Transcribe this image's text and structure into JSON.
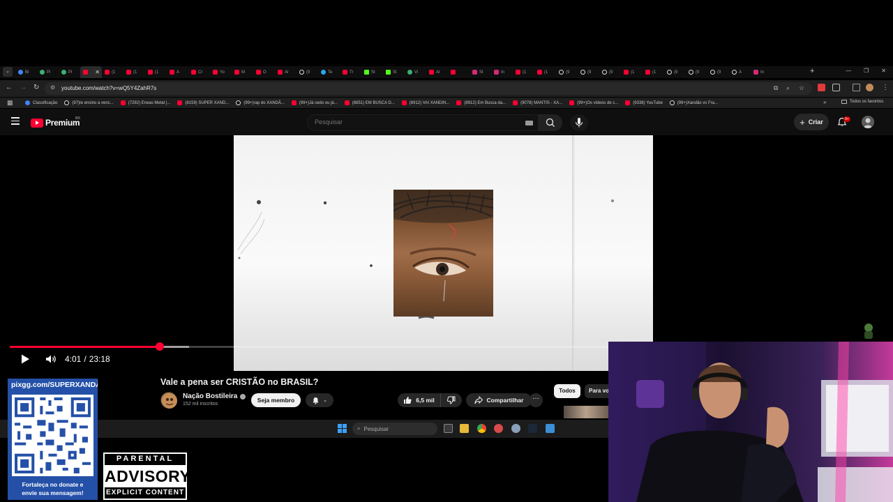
{
  "browser": {
    "tabs": [
      {
        "icon": "chrome-icon",
        "label": "Bi",
        "fav": "ch"
      },
      {
        "icon": "green-icon",
        "label": "Pi",
        "fav": "gn"
      },
      {
        "icon": "green-icon",
        "label": "Pi",
        "fav": "gn"
      },
      {
        "icon": "youtube-icon",
        "label": "",
        "fav": "yt",
        "active": true
      },
      {
        "icon": "youtube-icon",
        "label": "(1",
        "fav": "yt"
      },
      {
        "icon": "youtube-icon",
        "label": "(1",
        "fav": "yt"
      },
      {
        "icon": "youtube-icon",
        "label": "(1",
        "fav": "yt"
      },
      {
        "icon": "youtube-icon",
        "label": "A",
        "fav": "yt"
      },
      {
        "icon": "youtube-icon",
        "label": "Cr",
        "fav": "yt"
      },
      {
        "icon": "youtube-icon",
        "label": "Yo",
        "fav": "yt"
      },
      {
        "icon": "youtube-icon",
        "label": "M",
        "fav": "yt"
      },
      {
        "icon": "youtube-icon",
        "label": "O",
        "fav": "yt"
      },
      {
        "icon": "youtube-icon",
        "label": "Al",
        "fav": "yt"
      },
      {
        "icon": "tiktok-icon",
        "label": "(9",
        "fav": "tt"
      },
      {
        "icon": "telegram-icon",
        "label": "Te",
        "fav": "tg"
      },
      {
        "icon": "youtube-icon",
        "label": "Tr",
        "fav": "yt"
      },
      {
        "icon": "kick-icon",
        "label": "St",
        "fav": "kk"
      },
      {
        "icon": "kick-icon",
        "label": "St",
        "fav": "kk"
      },
      {
        "icon": "globe-icon",
        "label": "Vi",
        "fav": "gn"
      },
      {
        "icon": "youtube-icon",
        "label": "Al",
        "fav": "yt"
      },
      {
        "icon": "youtube-icon",
        "label": "",
        "fav": "yt"
      },
      {
        "icon": "instagram-icon",
        "label": "St",
        "fav": "ig"
      },
      {
        "icon": "instagram-icon",
        "label": "In",
        "fav": "ig"
      },
      {
        "icon": "youtube-icon",
        "label": "(1",
        "fav": "yt"
      },
      {
        "icon": "youtube-icon",
        "label": "(1",
        "fav": "yt"
      },
      {
        "icon": "tiktok-icon",
        "label": "(9",
        "fav": "tt"
      },
      {
        "icon": "tiktok-icon",
        "label": "(9",
        "fav": "tt"
      },
      {
        "icon": "tiktok-icon",
        "label": "(9",
        "fav": "tt"
      },
      {
        "icon": "youtube-icon",
        "label": "(1",
        "fav": "yt"
      },
      {
        "icon": "youtube-icon",
        "label": "(1",
        "fav": "yt"
      },
      {
        "icon": "tiktok-icon",
        "label": "(9",
        "fav": "tt"
      },
      {
        "icon": "tiktok-icon",
        "label": "(9",
        "fav": "tt"
      },
      {
        "icon": "tiktok-icon",
        "label": "(9",
        "fav": "tt"
      },
      {
        "icon": "tiktok-icon",
        "label": "A",
        "fav": "tt"
      },
      {
        "icon": "instagram-icon",
        "label": "In",
        "fav": "ig"
      }
    ],
    "url": "youtube.com/watch?v=wQ5Y4ZahR7s",
    "bookmarks": [
      {
        "label": "Classificação",
        "fav": "ch"
      },
      {
        "label": "(97)Ie ensino a venc...",
        "fav": "tt"
      },
      {
        "label": "(7292) Eneas Metal |...",
        "fav": "yt"
      },
      {
        "label": "(8159) SUPER XAND...",
        "fav": "yt"
      },
      {
        "label": "(99+)rap do XANDÃ...",
        "fav": "tt"
      },
      {
        "label": "(99+)Já cedo ou já...",
        "fav": "yt"
      },
      {
        "label": "(8851) EM BUSCA D...",
        "fav": "yt"
      },
      {
        "label": "(8912) VAI XANDIN...",
        "fav": "yt"
      },
      {
        "label": "(8912) Em Busca da...",
        "fav": "yt"
      },
      {
        "label": "(9078) MANTIS - XA...",
        "fav": "yt"
      },
      {
        "label": "(99+)Os vídeos de c...",
        "fav": "yt"
      },
      {
        "label": "(9338) YouTube",
        "fav": "yt"
      },
      {
        "label": "(99+)Xandão vs Fra...",
        "fav": "tt"
      }
    ],
    "all_bookmarks": "Todos os favoritos"
  },
  "youtube": {
    "logo_text": "Premium",
    "country": "BR",
    "search_placeholder": "Pesquisar",
    "create_label": "Criar",
    "notifications": "9+"
  },
  "player": {
    "current_time": "4:01",
    "duration": "23:18",
    "played_fraction": 0.172,
    "buffered_fraction": 0.205
  },
  "video": {
    "title": "Vale a pena ser CRISTÃO no BRASIL?",
    "channel": "Nação Bostileira",
    "subscribers": "152 mil inscritos",
    "join_label": "Seja membro",
    "likes": "6,5 mil",
    "share_label": "Compartilhar",
    "chips": [
      "Todos",
      "Para vo"
    ]
  },
  "taskbar": {
    "search_placeholder": "Pesquisar"
  },
  "overlay": {
    "qr_handle": "pixgg.com/SUPERXANDÃO",
    "qr_caption_line1": "Fortaleça no donate e",
    "qr_caption_line2": "envie sua mensagem!",
    "advisory_top": "PARENTAL",
    "advisory_mid": "ADVISORY",
    "advisory_bottom": "EXPLICIT CONTENT"
  },
  "colors": {
    "yt_red": "#ff0033",
    "qr_panel": "#2450a8",
    "chrome_bg": "#1f1f1f"
  }
}
